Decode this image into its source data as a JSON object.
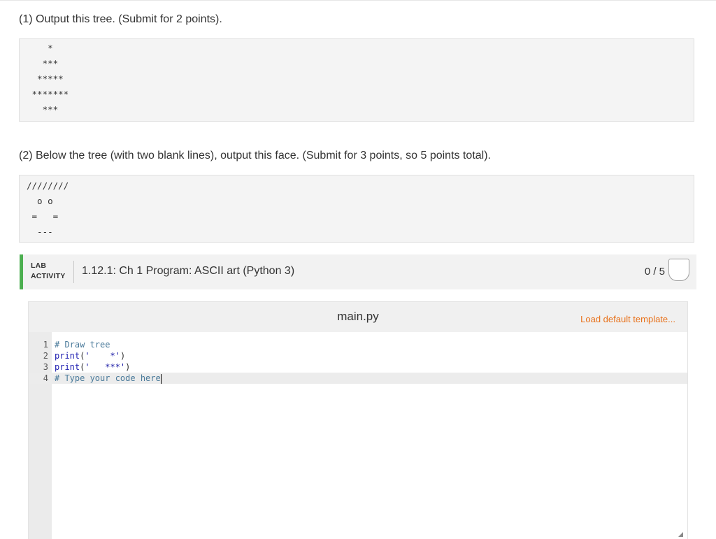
{
  "instructions": {
    "step1": "(1) Output this tree. (Submit for 2 points).",
    "step2": "(2) Below the tree (with two blank lines), output this face. (Submit for 3 points, so 5 points total)."
  },
  "tree_output": {
    "lines": [
      "    *",
      "   ***",
      "  *****",
      " *******",
      "   ***"
    ]
  },
  "face_output": {
    "lines": [
      "////////",
      "  o o",
      " =   =",
      "  ---"
    ]
  },
  "lab": {
    "tag_line1": "LAB",
    "tag_line2": "ACTIVITY",
    "title": "1.12.1: Ch 1 Program: ASCII art (Python 3)",
    "score": "0 / 5",
    "accent_color": "#4caf50"
  },
  "editor": {
    "file_name": "main.py",
    "load_template_label": "Load default template...",
    "load_template_color": "#e8711a",
    "lines": [
      {
        "num": "1",
        "comment": "# Draw tree"
      },
      {
        "num": "2",
        "fn": "print",
        "open": "(",
        "string": "'    *'",
        "close": ")"
      },
      {
        "num": "3",
        "fn": "print",
        "open": "(",
        "string": "'   ***'",
        "close": ")"
      },
      {
        "num": "4",
        "comment": "# Type your code here"
      }
    ]
  }
}
